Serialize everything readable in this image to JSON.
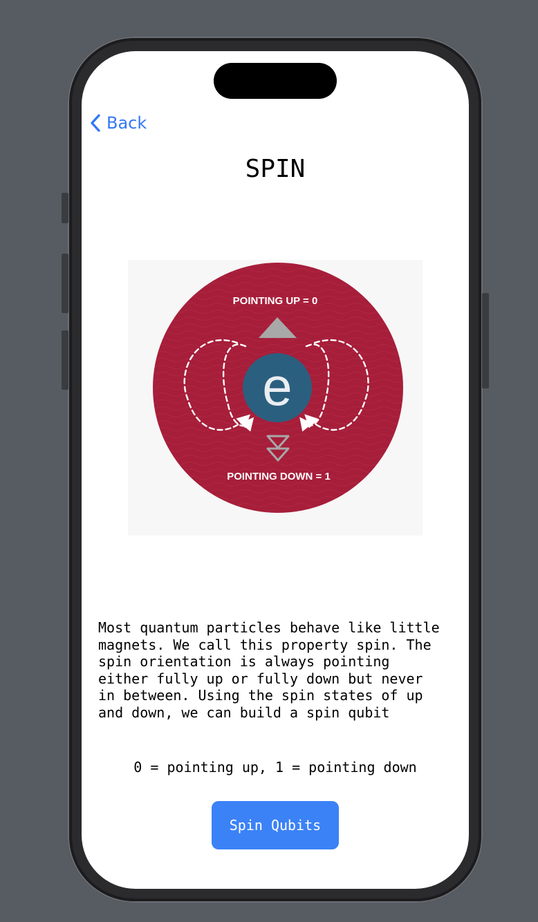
{
  "nav": {
    "back_label": "Back"
  },
  "page": {
    "title": "SPIN"
  },
  "illustration": {
    "up_label": "POINTING UP = 0",
    "down_label": "POINTING DOWN = 1",
    "particle_letter": "e",
    "colors": {
      "disc": "#a61e3a",
      "particle": "#2b5f7f",
      "arrow": "#a8a8a8",
      "background": "#f7f7f7"
    }
  },
  "content": {
    "description": "Most quantum particles behave like little\nmagnets. We call this property spin. The\nspin orientation is always pointing\neither fully up or fully down but never\nin between. Using the spin states of up\nand down, we can build a spin qubit",
    "legend": "0 = pointing up, 1 = pointing down"
  },
  "actions": {
    "primary_label": "Spin Qubits"
  },
  "colors": {
    "accent": "#3478f6",
    "button": "#3b82f6"
  }
}
